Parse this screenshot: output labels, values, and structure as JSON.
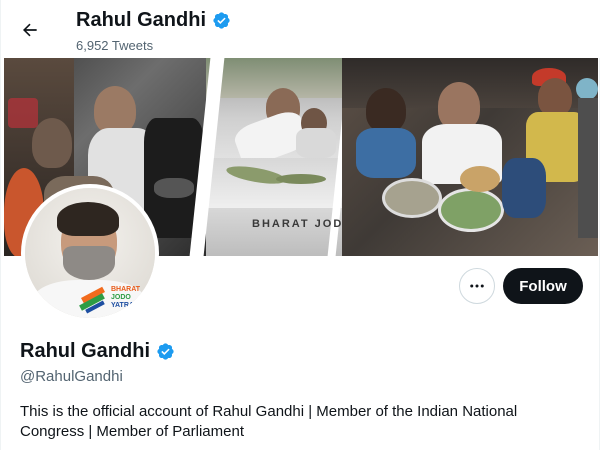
{
  "header": {
    "name": "Rahul Gandhi",
    "tweet_count": "6,952 Tweets"
  },
  "banner": {
    "label": "BHARAT JODO"
  },
  "avatar": {
    "logo_text_line1": "BHARAT",
    "logo_text_line2": "JODO",
    "logo_text_line3": "YATRA"
  },
  "actions": {
    "more_label": "•••",
    "follow_label": "Follow"
  },
  "profile": {
    "name": "Rahul Gandhi",
    "handle": "@RahulGandhi",
    "bio": "This is the official account of Rahul Gandhi | Member of the Indian National Congress | Member of Parliament"
  },
  "colors": {
    "verified": "#1d9bf0",
    "follow_bg": "#0f1419",
    "muted_text": "#536471"
  },
  "icons": {
    "back": "arrow-left-icon",
    "verified": "verified-badge-icon",
    "more": "more-horizontal-icon"
  }
}
